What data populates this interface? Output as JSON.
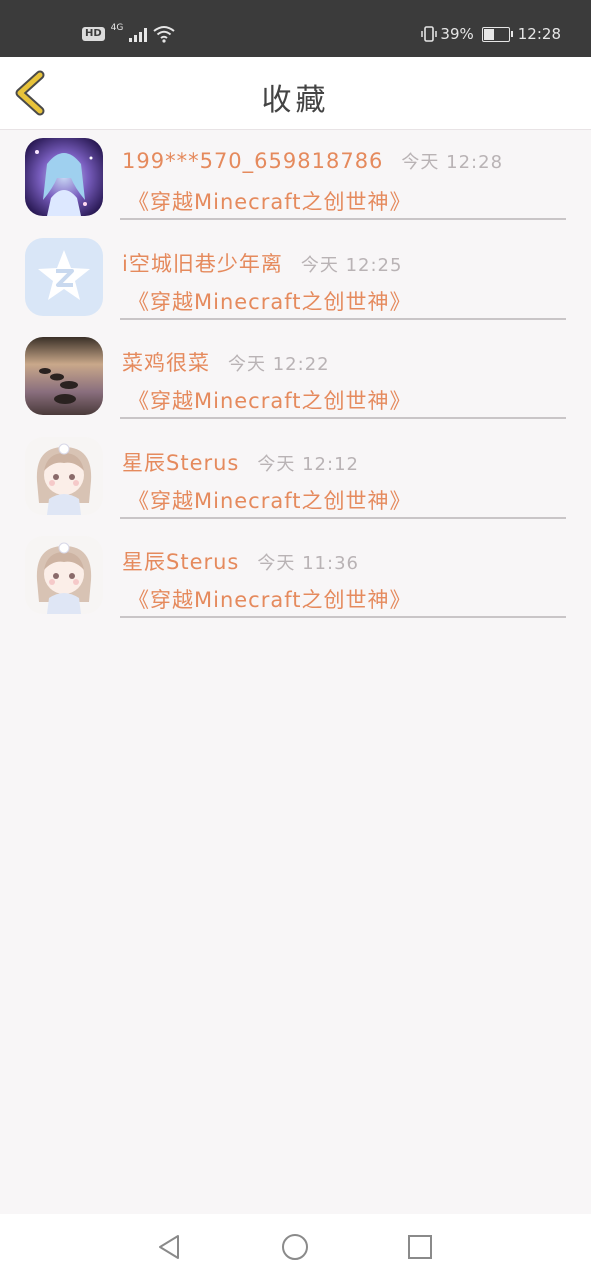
{
  "status": {
    "hd": "HD",
    "network": "4G",
    "battery_percent": "39%",
    "battery_level": 0.39,
    "time": "12:28"
  },
  "header": {
    "title": "收藏"
  },
  "favorites": [
    {
      "user": "199***570_659818786",
      "time": "今天 12:28",
      "book": "《穿越Minecraft之创世神》",
      "avatar": "anime-girl-blue-hair-avatar"
    },
    {
      "user": "i空城旧巷少年离",
      "time": "今天 12:25",
      "book": "《穿越Minecraft之创世神》",
      "avatar": "qq-default-avatar"
    },
    {
      "user": "菜鸡很菜",
      "time": "今天 12:22",
      "book": "《穿越Minecraft之创世神》",
      "avatar": "lake-sunset-avatar"
    },
    {
      "user": "星辰Sterus",
      "time": "今天 12:12",
      "book": "《穿越Minecraft之创世神》",
      "avatar": "chibi-girl-avatar"
    },
    {
      "user": "星辰Sterus",
      "time": "今天 11:36",
      "book": "《穿越Minecraft之创世神》",
      "avatar": "chibi-girl-avatar"
    }
  ],
  "colors": {
    "accent": "#e58a5d",
    "back_arrow": "#e8c33a",
    "time_text": "#b9b3b5"
  }
}
